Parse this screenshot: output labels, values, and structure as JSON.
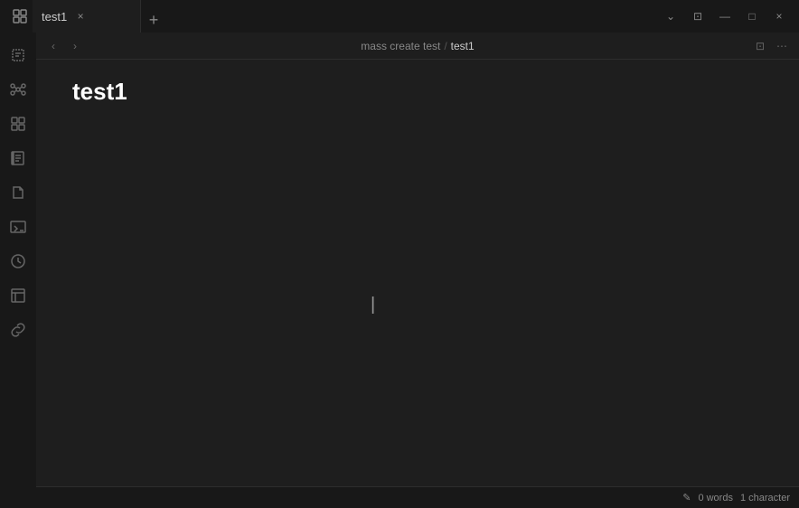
{
  "titlebar": {
    "tab_label": "test1",
    "tab_close": "×",
    "tab_new": "+",
    "btn_dropdown": "⌄",
    "btn_layout": "⊡",
    "btn_minimize": "—",
    "btn_maximize": "□",
    "btn_close": "×"
  },
  "sidebar": {
    "icons": [
      {
        "name": "pages-icon",
        "label": "Pages"
      },
      {
        "name": "graph-icon",
        "label": "Graph"
      },
      {
        "name": "plugins-icon",
        "label": "Plugins"
      },
      {
        "name": "journal-icon",
        "label": "Journal"
      },
      {
        "name": "documents-icon",
        "label": "Documents"
      },
      {
        "name": "terminal-icon",
        "label": "Terminal"
      },
      {
        "name": "clock-icon",
        "label": "Recent"
      },
      {
        "name": "template-icon",
        "label": "Templates"
      },
      {
        "name": "link-icon",
        "label": "Links"
      }
    ]
  },
  "breadcrumb": {
    "parent": "mass create test",
    "separator": "/",
    "current": "test1",
    "nav_back": "‹",
    "nav_forward": "›",
    "btn_read": "⊡",
    "btn_more": "⋯"
  },
  "editor": {
    "title": "test1",
    "content": ""
  },
  "statusbar": {
    "edit_icon": "✎",
    "words_label": "0 words",
    "character_label": "1 character"
  }
}
